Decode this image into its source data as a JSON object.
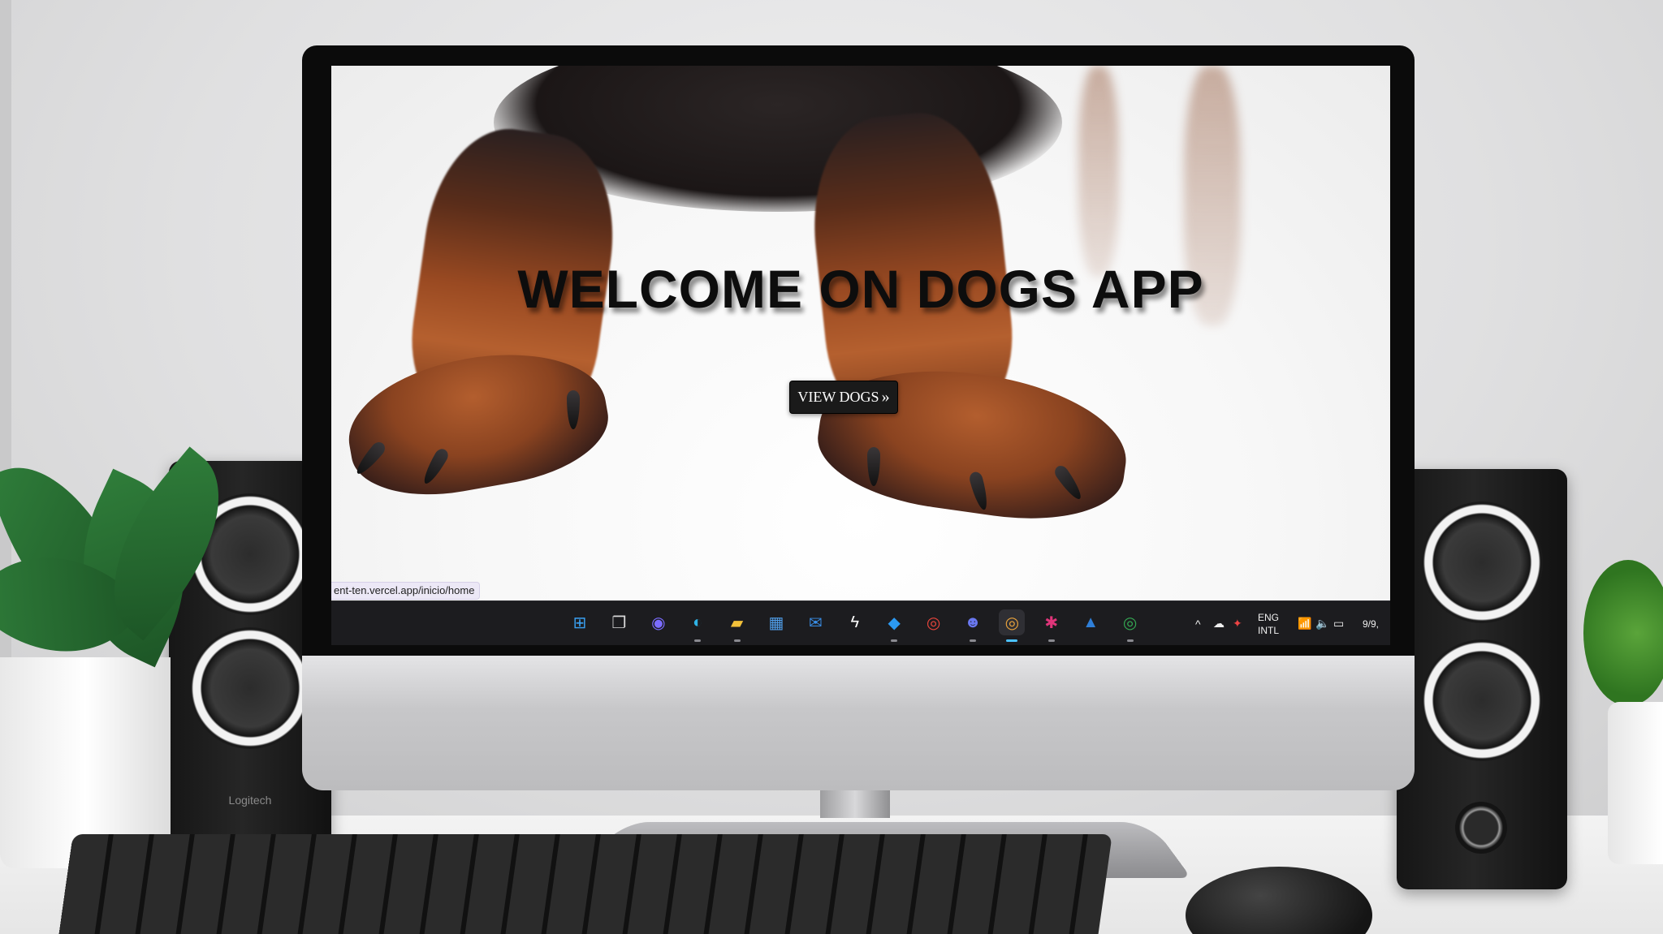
{
  "hero": {
    "title": "WELCOME ON DOGS APP",
    "button_label": "VIEW DOGS",
    "button_chevron": "»"
  },
  "status_bar": {
    "url": "ent-ten.vercel.app/inicio/home"
  },
  "taskbar": {
    "icons": [
      {
        "name": "windows-start-icon",
        "glyph": "⊞",
        "color": "#3aa0f0"
      },
      {
        "name": "task-view-icon",
        "glyph": "❐",
        "color": "#d8d8d8"
      },
      {
        "name": "teams-chat-icon",
        "glyph": "◉",
        "color": "#7b6cff"
      },
      {
        "name": "edge-browser-icon",
        "glyph": "◐",
        "color": "#2fb3e6"
      },
      {
        "name": "file-explorer-icon",
        "glyph": "▰",
        "color": "#f3c13a"
      },
      {
        "name": "microsoft-store-icon",
        "glyph": "▦",
        "color": "#4f9de8"
      },
      {
        "name": "mail-icon",
        "glyph": "✉",
        "color": "#3a8fe8"
      },
      {
        "name": "lightning-app-icon",
        "glyph": "ϟ",
        "color": "#ffffff"
      },
      {
        "name": "vscode-icon",
        "glyph": "◆",
        "color": "#2b9af3"
      },
      {
        "name": "chrome-icon",
        "glyph": "◎",
        "color": "#e8453c"
      },
      {
        "name": "discord-icon",
        "glyph": "☻",
        "color": "#6a78f0"
      },
      {
        "name": "chrome-profile-icon",
        "glyph": "◎",
        "color": "#e8a23c"
      },
      {
        "name": "slack-icon",
        "glyph": "✱",
        "color": "#e0357a"
      },
      {
        "name": "photos-icon",
        "glyph": "▲",
        "color": "#2f7fd8"
      },
      {
        "name": "chrome-profile-m-icon",
        "glyph": "◎",
        "color": "#34a853"
      }
    ],
    "tray": {
      "chevron": "^",
      "lang_line1": "ENG",
      "lang_line2": "INTL",
      "date_fragment": "9/9,"
    }
  },
  "speaker": {
    "brand": "Logitech"
  },
  "colors": {
    "taskbar_bg": "#1c1c1f",
    "button_bg": "#1a1a1a",
    "status_bg": "#ece8f6"
  }
}
